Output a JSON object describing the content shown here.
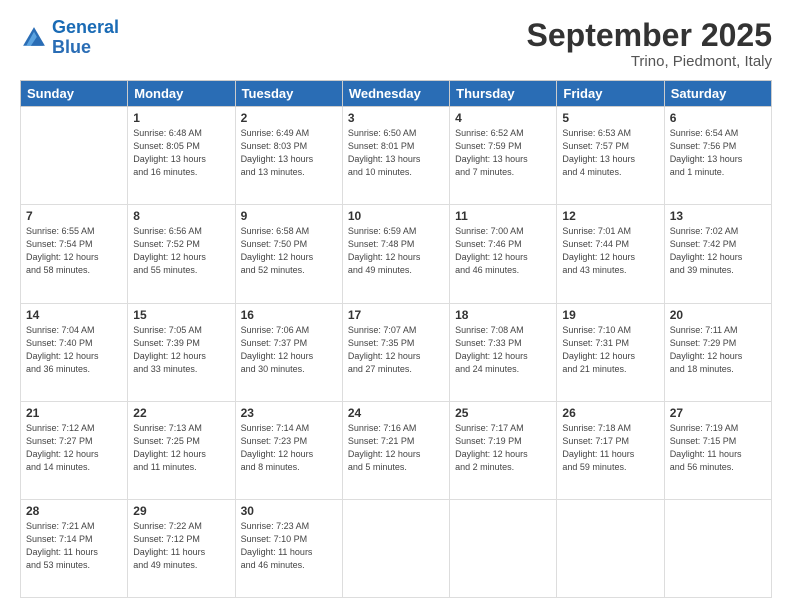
{
  "header": {
    "logo_line1": "General",
    "logo_line2": "Blue",
    "month": "September 2025",
    "location": "Trino, Piedmont, Italy"
  },
  "weekdays": [
    "Sunday",
    "Monday",
    "Tuesday",
    "Wednesday",
    "Thursday",
    "Friday",
    "Saturday"
  ],
  "weeks": [
    [
      {
        "day": "",
        "info": ""
      },
      {
        "day": "1",
        "info": "Sunrise: 6:48 AM\nSunset: 8:05 PM\nDaylight: 13 hours\nand 16 minutes."
      },
      {
        "day": "2",
        "info": "Sunrise: 6:49 AM\nSunset: 8:03 PM\nDaylight: 13 hours\nand 13 minutes."
      },
      {
        "day": "3",
        "info": "Sunrise: 6:50 AM\nSunset: 8:01 PM\nDaylight: 13 hours\nand 10 minutes."
      },
      {
        "day": "4",
        "info": "Sunrise: 6:52 AM\nSunset: 7:59 PM\nDaylight: 13 hours\nand 7 minutes."
      },
      {
        "day": "5",
        "info": "Sunrise: 6:53 AM\nSunset: 7:57 PM\nDaylight: 13 hours\nand 4 minutes."
      },
      {
        "day": "6",
        "info": "Sunrise: 6:54 AM\nSunset: 7:56 PM\nDaylight: 13 hours\nand 1 minute."
      }
    ],
    [
      {
        "day": "7",
        "info": "Sunrise: 6:55 AM\nSunset: 7:54 PM\nDaylight: 12 hours\nand 58 minutes."
      },
      {
        "day": "8",
        "info": "Sunrise: 6:56 AM\nSunset: 7:52 PM\nDaylight: 12 hours\nand 55 minutes."
      },
      {
        "day": "9",
        "info": "Sunrise: 6:58 AM\nSunset: 7:50 PM\nDaylight: 12 hours\nand 52 minutes."
      },
      {
        "day": "10",
        "info": "Sunrise: 6:59 AM\nSunset: 7:48 PM\nDaylight: 12 hours\nand 49 minutes."
      },
      {
        "day": "11",
        "info": "Sunrise: 7:00 AM\nSunset: 7:46 PM\nDaylight: 12 hours\nand 46 minutes."
      },
      {
        "day": "12",
        "info": "Sunrise: 7:01 AM\nSunset: 7:44 PM\nDaylight: 12 hours\nand 43 minutes."
      },
      {
        "day": "13",
        "info": "Sunrise: 7:02 AM\nSunset: 7:42 PM\nDaylight: 12 hours\nand 39 minutes."
      }
    ],
    [
      {
        "day": "14",
        "info": "Sunrise: 7:04 AM\nSunset: 7:40 PM\nDaylight: 12 hours\nand 36 minutes."
      },
      {
        "day": "15",
        "info": "Sunrise: 7:05 AM\nSunset: 7:39 PM\nDaylight: 12 hours\nand 33 minutes."
      },
      {
        "day": "16",
        "info": "Sunrise: 7:06 AM\nSunset: 7:37 PM\nDaylight: 12 hours\nand 30 minutes."
      },
      {
        "day": "17",
        "info": "Sunrise: 7:07 AM\nSunset: 7:35 PM\nDaylight: 12 hours\nand 27 minutes."
      },
      {
        "day": "18",
        "info": "Sunrise: 7:08 AM\nSunset: 7:33 PM\nDaylight: 12 hours\nand 24 minutes."
      },
      {
        "day": "19",
        "info": "Sunrise: 7:10 AM\nSunset: 7:31 PM\nDaylight: 12 hours\nand 21 minutes."
      },
      {
        "day": "20",
        "info": "Sunrise: 7:11 AM\nSunset: 7:29 PM\nDaylight: 12 hours\nand 18 minutes."
      }
    ],
    [
      {
        "day": "21",
        "info": "Sunrise: 7:12 AM\nSunset: 7:27 PM\nDaylight: 12 hours\nand 14 minutes."
      },
      {
        "day": "22",
        "info": "Sunrise: 7:13 AM\nSunset: 7:25 PM\nDaylight: 12 hours\nand 11 minutes."
      },
      {
        "day": "23",
        "info": "Sunrise: 7:14 AM\nSunset: 7:23 PM\nDaylight: 12 hours\nand 8 minutes."
      },
      {
        "day": "24",
        "info": "Sunrise: 7:16 AM\nSunset: 7:21 PM\nDaylight: 12 hours\nand 5 minutes."
      },
      {
        "day": "25",
        "info": "Sunrise: 7:17 AM\nSunset: 7:19 PM\nDaylight: 12 hours\nand 2 minutes."
      },
      {
        "day": "26",
        "info": "Sunrise: 7:18 AM\nSunset: 7:17 PM\nDaylight: 11 hours\nand 59 minutes."
      },
      {
        "day": "27",
        "info": "Sunrise: 7:19 AM\nSunset: 7:15 PM\nDaylight: 11 hours\nand 56 minutes."
      }
    ],
    [
      {
        "day": "28",
        "info": "Sunrise: 7:21 AM\nSunset: 7:14 PM\nDaylight: 11 hours\nand 53 minutes."
      },
      {
        "day": "29",
        "info": "Sunrise: 7:22 AM\nSunset: 7:12 PM\nDaylight: 11 hours\nand 49 minutes."
      },
      {
        "day": "30",
        "info": "Sunrise: 7:23 AM\nSunset: 7:10 PM\nDaylight: 11 hours\nand 46 minutes."
      },
      {
        "day": "",
        "info": ""
      },
      {
        "day": "",
        "info": ""
      },
      {
        "day": "",
        "info": ""
      },
      {
        "day": "",
        "info": ""
      }
    ]
  ]
}
